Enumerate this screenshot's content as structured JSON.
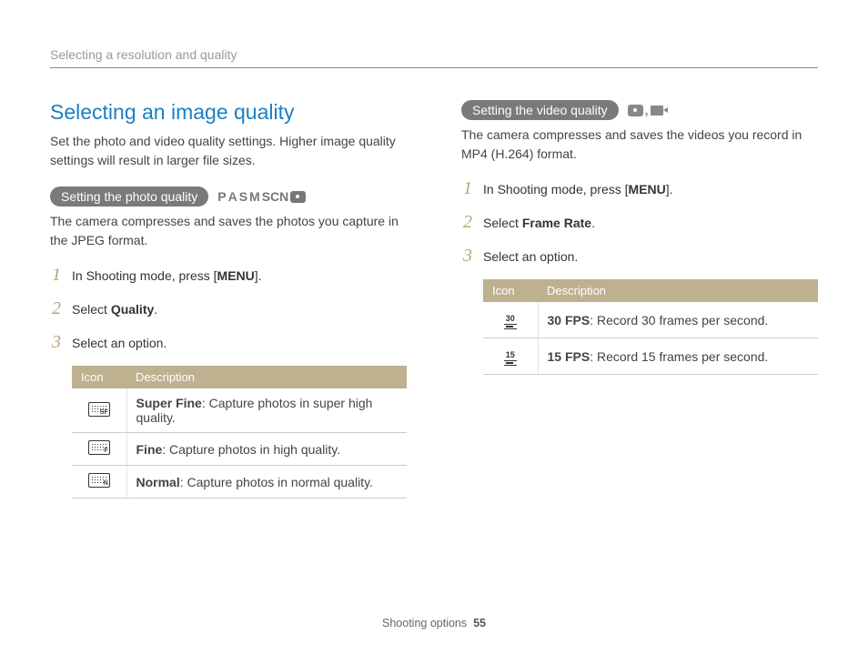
{
  "breadcrumb": "Selecting a resolution and quality",
  "left": {
    "title": "Selecting an image quality",
    "intro": "Set the photo and video quality settings. Higher image quality settings will result in larger file sizes.",
    "pill": "Setting the photo quality",
    "modes": {
      "p": "P",
      "a": "A",
      "s": "S",
      "m": "M",
      "scn": "SCN"
    },
    "desc": "The camera compresses and saves the photos you capture in the JPEG format.",
    "step1_a": "In Shooting mode, press [",
    "menu": "MENU",
    "step1_b": "].",
    "step2_a": "Select ",
    "step2_b": "Quality",
    "step2_c": ".",
    "step3": "Select an option.",
    "table": {
      "h1": "Icon",
      "h2": "Description",
      "r1b": "Super Fine",
      "r1t": ": Capture photos in super high quality.",
      "r2b": "Fine",
      "r2t": ": Capture photos in high quality.",
      "r3b": "Normal",
      "r3t": ": Capture photos in normal quality."
    }
  },
  "right": {
    "pill": "Setting the video quality",
    "desc": "The camera compresses and saves the videos you record in MP4 (H.264) format.",
    "step1_a": "In Shooting mode, press [",
    "menu": "MENU",
    "step1_b": "].",
    "step2_a": "Select ",
    "step2_b": "Frame Rate",
    "step2_c": ".",
    "step3": "Select an option.",
    "table": {
      "h1": "Icon",
      "h2": "Description",
      "r1n": "30",
      "r1b": "30 FPS",
      "r1t": ": Record 30 frames per second.",
      "r2n": "15",
      "r2b": "15 FPS",
      "r2t": ": Record 15 frames per second."
    }
  },
  "footer": {
    "label": "Shooting options",
    "page": "55"
  }
}
